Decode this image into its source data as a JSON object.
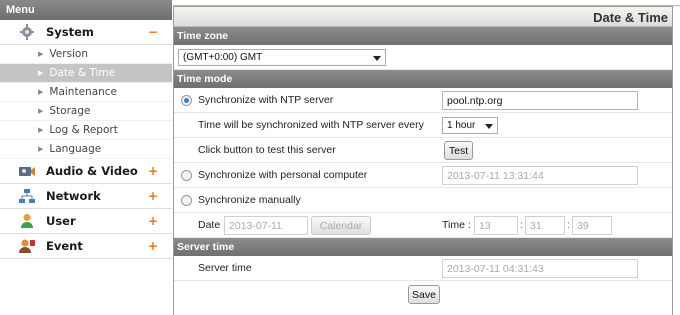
{
  "sidebar": {
    "header": "Menu",
    "system": {
      "label": "System",
      "sign": "−"
    },
    "sub_items": [
      "Version",
      "Date & Time",
      "Maintenance",
      "Storage",
      "Log & Report",
      "Language"
    ],
    "audio_video": {
      "label": "Audio & Video",
      "sign": "+"
    },
    "network": {
      "label": "Network",
      "sign": "+"
    },
    "user": {
      "label": "User",
      "sign": "+"
    },
    "event": {
      "label": "Event",
      "sign": "+"
    }
  },
  "page": {
    "title": "Date & Time"
  },
  "timezone": {
    "header": "Time zone",
    "value": "(GMT+0:00) GMT"
  },
  "timemode": {
    "header": "Time mode",
    "ntp_label": "Synchronize with NTP server",
    "ntp_server": "pool.ntp.org",
    "interval_label": "Time will be synchronized with NTP server every",
    "interval_value": "1 hour",
    "test_label": "Click button to test this server",
    "test_button": "Test",
    "pc_label": "Synchronize with personal computer",
    "pc_time": "2013-07-11 13:31:44",
    "manual_label": "Synchronize manually",
    "date_label": "Date :",
    "date_value": "2013-07-11",
    "calendar_button": "Calendar",
    "time_label": "Time :",
    "hour": "13",
    "minute": "31",
    "second": "39"
  },
  "servertime": {
    "header": "Server time",
    "label": "Server time",
    "value": "2013-07-11 04:31:43"
  },
  "save_button": "Save"
}
